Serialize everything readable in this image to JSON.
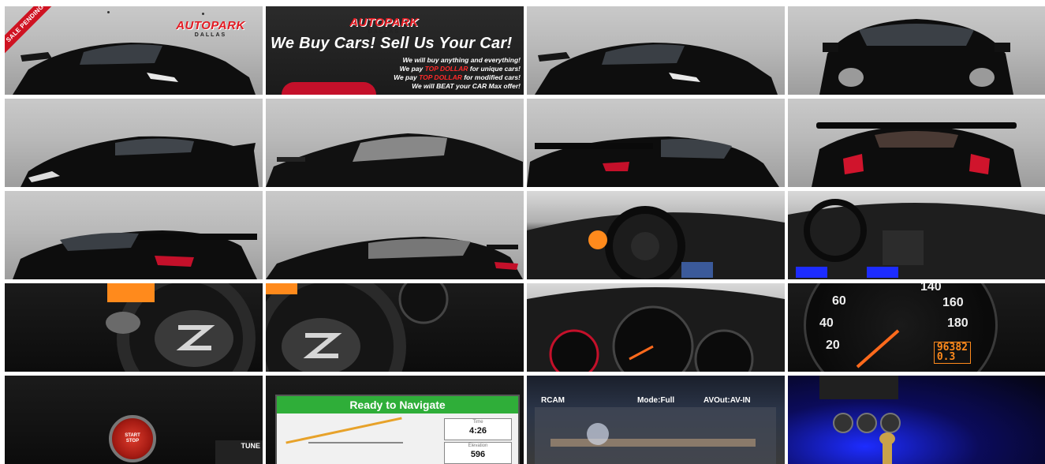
{
  "gallery": {
    "sale_badge": "SALE PENDING",
    "logo": {
      "name": "AUTOPARK",
      "city": "DALLAS"
    },
    "ad": {
      "headline": "We Buy Cars!  Sell Us Your Car!",
      "line1": "We will buy anything and everything!",
      "line2_pre": "We pay ",
      "line2_hl": "TOP DOLLAR",
      "line2_post": " for unique cars!",
      "line3_pre": "We pay ",
      "line3_hl": "TOP DOLLAR",
      "line3_post": " for modified cars!",
      "line4": "We will BEAT your CAR Max offer!"
    },
    "odometer": "96382",
    "trip": "0.3",
    "gauge_labels": [
      "60",
      "40",
      "20",
      "140",
      "160",
      "180"
    ],
    "start_button": [
      "START",
      "STOP"
    ],
    "tune_label": "TUNE",
    "nav": {
      "banner": "Ready to Navigate",
      "time_label": "Time",
      "time_value": "4:26",
      "elev_label": "Elevation",
      "elev_value": "596"
    },
    "rcam": {
      "label": "RCAM",
      "mode": "Mode:Full",
      "avout": "AVOut:AV-IN"
    }
  },
  "colors": {
    "brand_red": "#e31b23",
    "nav_green": "#2fae39",
    "ambient_blue": "#1d2cff"
  }
}
